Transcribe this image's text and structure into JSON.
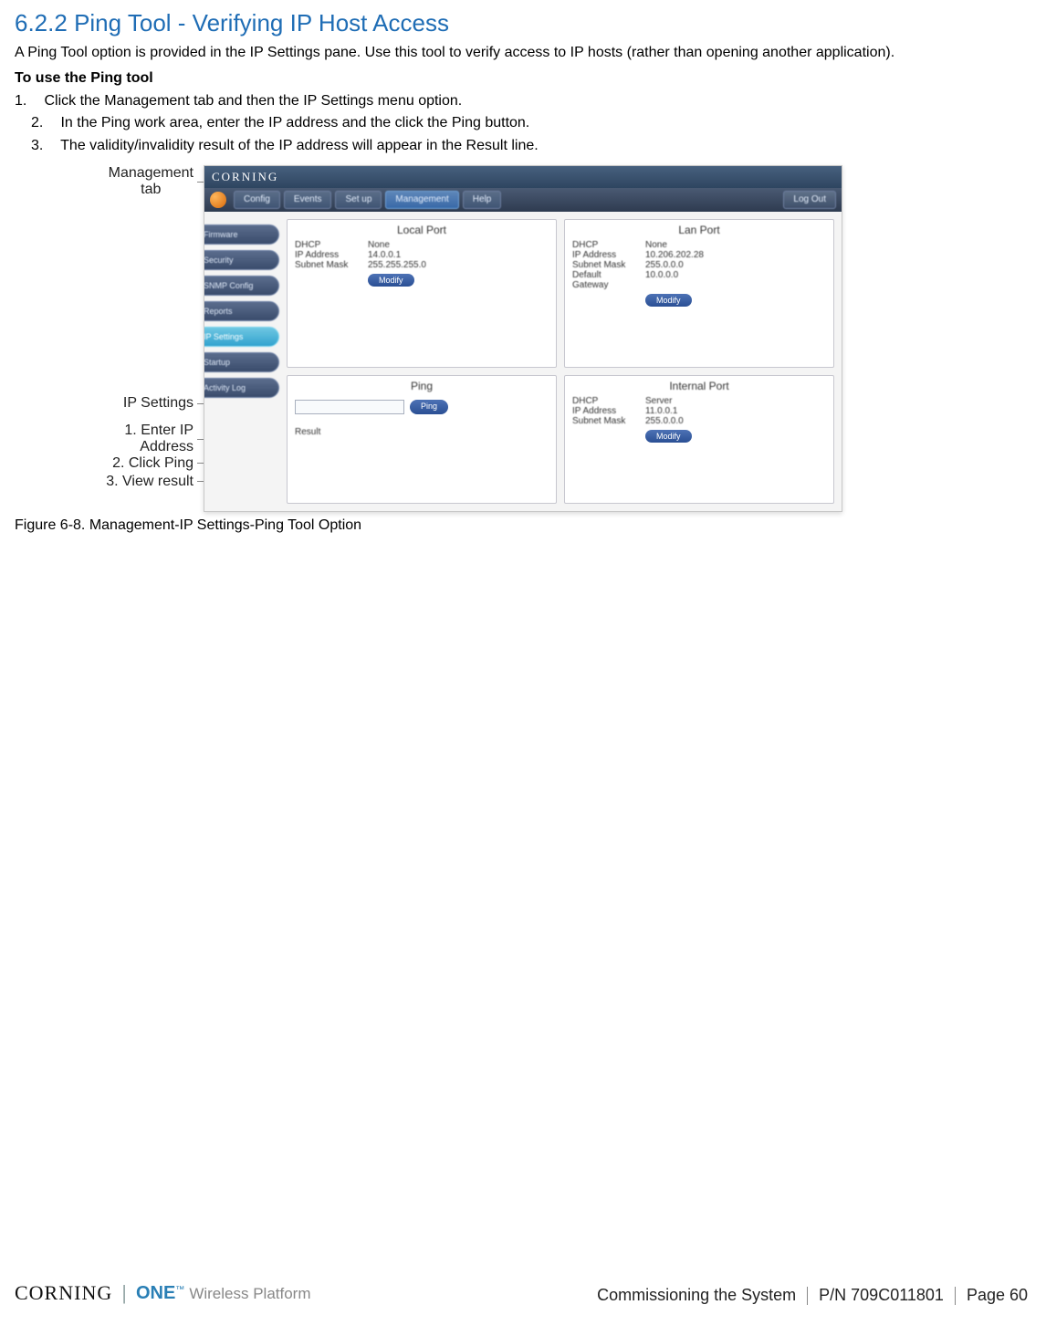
{
  "section": {
    "number": "6.2.2",
    "title": "Ping Tool - Verifying IP Host Access"
  },
  "intro": "A Ping Tool option is provided in the IP Settings pane. Use this tool to verify access to IP hosts (rather than opening another application).",
  "subheading": "To use the Ping tool",
  "steps": {
    "s1": "Click the Management tab and then the IP Settings menu option.",
    "s2": "In the Ping work area, enter the IP address and the click the Ping button.",
    "s3": "The validity/invalidity result of the IP address will appear in the Result line.",
    "n1": "1.",
    "n2": "2.",
    "n3": "3."
  },
  "annotations": {
    "management_tab": "Management\ntab",
    "ip_settings": "IP Settings",
    "enter_ip": "1. Enter IP\nAddress",
    "click_ping": "2. Click Ping",
    "view_result": "3. View result"
  },
  "figure_caption": "Figure 6-8. Management-IP Settings-Ping Tool Option",
  "ui": {
    "titlebar": "CORNING",
    "tabs": {
      "config": "Config",
      "events": "Events",
      "setup": "Set up",
      "management": "Management",
      "help": "Help",
      "logout": "Log Out"
    },
    "sidebar": {
      "firmware": "Firmware",
      "security": "Security",
      "snmp": "SNMP Config",
      "reports": "Reports",
      "ip_settings": "IP Settings",
      "startup": "Startup",
      "activitylog": "Activity Log"
    },
    "panels": {
      "local": {
        "title": "Local Port",
        "dhcp_k": "DHCP",
        "dhcp_v": "None",
        "ip_k": "IP Address",
        "ip_v": "14.0.0.1",
        "mask_k": "Subnet Mask",
        "mask_v": "255.255.255.0",
        "btn": "Modify"
      },
      "lan": {
        "title": "Lan Port",
        "dhcp_k": "DHCP",
        "dhcp_v": "None",
        "ip_k": "IP Address",
        "ip_v": "10.206.202.28",
        "mask_k": "Subnet Mask",
        "mask_v": "255.0.0.0",
        "gw_k": "Default Gateway",
        "gw_v": "10.0.0.0",
        "btn": "Modify"
      },
      "ping": {
        "title": "Ping",
        "btn": "Ping",
        "result_label": "Result"
      },
      "internal": {
        "title": "Internal Port",
        "dhcp_k": "DHCP",
        "dhcp_v": "Server",
        "ip_k": "IP Address",
        "ip_v": "11.0.0.1",
        "mask_k": "Subnet Mask",
        "mask_v": "255.0.0.0",
        "btn": "Modify"
      }
    }
  },
  "footer": {
    "brand_corning": "CORNING",
    "brand_one": "ONE",
    "brand_tm": "™",
    "brand_tag": "Wireless Platform",
    "chapter": "Commissioning the System",
    "pn": "P/N 709C011801",
    "page": "Page 60"
  }
}
